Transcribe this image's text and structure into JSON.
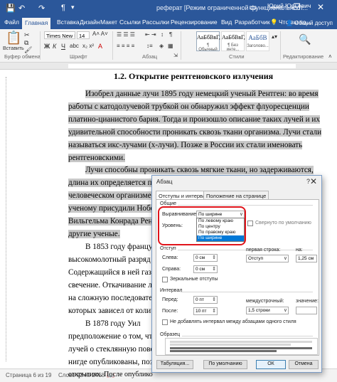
{
  "titlebar": {
    "title": "реферат [Режим ограниченной функциональност...",
    "user": "Юрий Юрьевич",
    "autosave_icon": "save-icon",
    "undo_icon": "undo-icon",
    "redo_icon": "redo-icon",
    "para_icon": "pilcrow-icon",
    "minimize": "—",
    "maximize": "❐",
    "close": "✕"
  },
  "tabs": [
    "Файл",
    "Главная",
    "Вставка",
    "Дизайн",
    "Макет",
    "Ссылки",
    "Рассылки",
    "Рецензирование",
    "Вид",
    "Разработчик"
  ],
  "tell_me": "Что вы хо...",
  "share": "Общий доступ",
  "ribbon": {
    "paste_label": "Вставить",
    "font_name": "Times New R",
    "font_size": "14",
    "clipboard_group": "Буфер обмена",
    "font_group": "Шрифт",
    "paragraph_group": "Абзац",
    "styles_group": "Стили",
    "editing_label": "Редактирование",
    "styles": [
      {
        "sample": "АаБбВвГ,",
        "name": "¶ Обычный"
      },
      {
        "sample": "АаБбВвГ,",
        "name": "¶ Без инте..."
      },
      {
        "sample": "АаБбВ",
        "name": "Заголово..."
      }
    ]
  },
  "document": {
    "heading": "1.2. Открытие рентгеновского излучения",
    "lines": [
      "Изобрел данные лучи 1895 году немецкий ученый Рентген: во время",
      "работы с катодолучевой трубкой он обнаружил эффект флуоресценции",
      "платино-цианистого бария. Тогда и произошло описание таких лучей и их",
      "удивительной способности проникать сквозь ткани организма. Лучи стали",
      "называться икс-лучами (х-лучи). Позже в России их стали именовать",
      "рентгеновскими.",
      "Лучи способны проникать сквозь мягкие ткани, но задерживаются,",
      "длина их определяется преп",
      "человеческом организме —",
      "ученому присудили Нобел",
      "Вильгельма Конрада Рентг",
      "другие ученые.",
      "В 1853 году францу",
      "высокомолотный разряд м",
      "Содержащийся в ней газ при",
      "свечение. Откачивание лишн",
      "на сложную последователь",
      "которых зависел от количест",
      "В 1878 году Уил",
      "предположение о том, что",
      "лучей о стеклянную поверх",
      "нигде опубликованы, позж",
      "открытиях. После опублико"
    ]
  },
  "status": {
    "page": "Страница 6 из 19",
    "words": "Слово 92 из 2468",
    "lang_icon": "spellcheck-icon"
  },
  "dialog": {
    "title": "Абзац",
    "close": "✕",
    "tabs": [
      "Отступы и интервалы",
      "Положение на странице"
    ],
    "general_section": "Общие",
    "alignment_label": "Выравнивание:",
    "alignment_value": "По ширине",
    "level_label": "Уровень:",
    "collapsed_label": "Свернуто по умолчанию",
    "alignment_options": [
      "По левому краю",
      "По центру",
      "По правому краю",
      "По ширине"
    ],
    "selected_option": "По ширине",
    "indent_section": "Отступ",
    "left_label": "Слева:",
    "left_value": "0 см",
    "right_label": "Справа:",
    "right_value": "0 см",
    "first_line_label": "первая строка:",
    "first_line_value": "Отступ",
    "by_label": "на:",
    "by_value": "1,25 см",
    "mirror_label": "Зеркальные отступы",
    "spacing_section": "Интервал",
    "before_label": "Перед:",
    "before_value": "0 пт",
    "after_label": "После:",
    "after_value": "10 пт",
    "line_spacing_label": "междустрочный:",
    "line_spacing_value": "1,5 строки",
    "value_label": "значение:",
    "no_space_label": "Не добавлять интервал между абзацами одного стиля",
    "preview_section": "Образец",
    "tabs_button": "Табуляция...",
    "default_button": "По умолчанию",
    "ok_button": "ОК",
    "cancel_button": "Отмена"
  },
  "colors": {
    "brand": "#2b579a",
    "highlight": "#c8c8c8",
    "callout": "#e0141b",
    "selection": "#0078d7"
  }
}
